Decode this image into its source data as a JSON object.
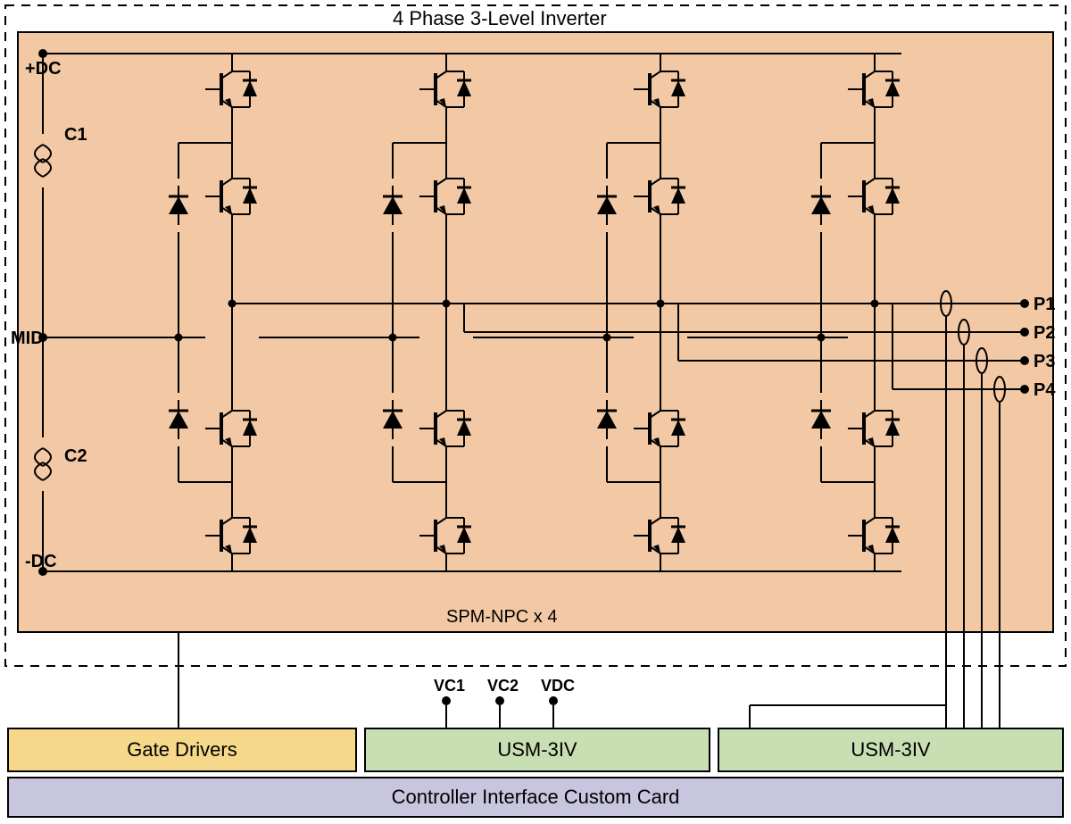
{
  "title": "4 Phase 3-Level Inverter",
  "module_label": "SPM-NPC x 4",
  "rails": {
    "pos": "+DC",
    "mid": "MID",
    "neg": "-DC"
  },
  "caps": {
    "c1": "C1",
    "c2": "C2"
  },
  "phases": {
    "p1": "P1",
    "p2": "P2",
    "p3": "P3",
    "p4": "P4"
  },
  "vdc_taps": {
    "vc1": "VC1",
    "vc2": "VC2",
    "vdc": "VDC"
  },
  "blocks": {
    "gate": "Gate Drivers",
    "usm1": "USM-3IV",
    "usm2": "USM-3IV",
    "ctrl": "Controller Interface Custom Card"
  },
  "colors": {
    "inverter_fill": "#F2C9A4",
    "gate_fill": "#F5D88A",
    "usm_fill": "#C8DFB3",
    "ctrl_fill": "#C8C6DE"
  }
}
